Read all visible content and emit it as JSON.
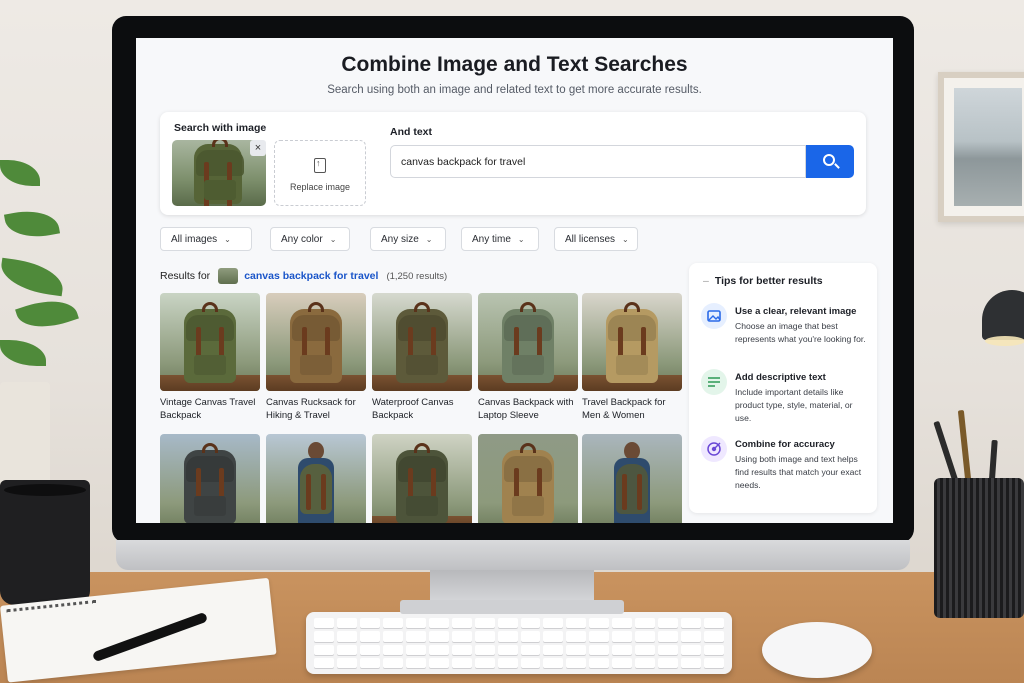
{
  "page": {
    "title": "Combine Image and Text Searches",
    "subtitle": "Search using both an image and related text to get more accurate results."
  },
  "search": {
    "image_label": "Search with image",
    "remove_image_symbol": "×",
    "replace_image_label": "Replace image",
    "text_label": "And text",
    "query": "canvas backpack for travel",
    "button_icon": "search-icon",
    "accent_color": "#1a66e8"
  },
  "filters": [
    {
      "label": "All images"
    },
    {
      "label": "Any color"
    },
    {
      "label": "Any size"
    },
    {
      "label": "Any time"
    },
    {
      "label": "All licenses"
    }
  ],
  "results": {
    "prefix": "Results for",
    "query": "canvas backpack for travel",
    "count": "(1,250 results)",
    "items": [
      {
        "caption": "Vintage Canvas Travel Backpack",
        "color": "#5b6a3b"
      },
      {
        "caption": "Canvas Rucksack for Hiking & Travel",
        "color": "#8a6a3e"
      },
      {
        "caption": "Waterproof Canvas Backpack",
        "color": "#5d5a3a"
      },
      {
        "caption": "Canvas Backpack with Laptop Sleeve",
        "color": "#6f8066"
      },
      {
        "caption": "Travel Backpack for Men & Women",
        "color": "#b59a62"
      },
      {
        "caption": "",
        "color": "#3f4444"
      },
      {
        "caption": "",
        "color": "#57603f"
      },
      {
        "caption": "",
        "color": "#4d543a"
      },
      {
        "caption": "",
        "color": "#a0824f"
      },
      {
        "caption": "",
        "color": "#4d5640"
      }
    ]
  },
  "tips": {
    "title": "Tips for better results",
    "items": [
      {
        "title": "Use a clear, relevant image",
        "desc": "Choose an image that best represents what you're looking for.",
        "icon": "image-icon",
        "color": "#e6efff"
      },
      {
        "title": "Add descriptive text",
        "desc": "Include important details like product type, style, material, or use.",
        "icon": "text-lines-icon",
        "color": "#e3f5ea"
      },
      {
        "title": "Combine for accuracy",
        "desc": "Using both image and text helps find results that match your exact needs.",
        "icon": "target-icon",
        "color": "#efe8ff"
      }
    ]
  }
}
